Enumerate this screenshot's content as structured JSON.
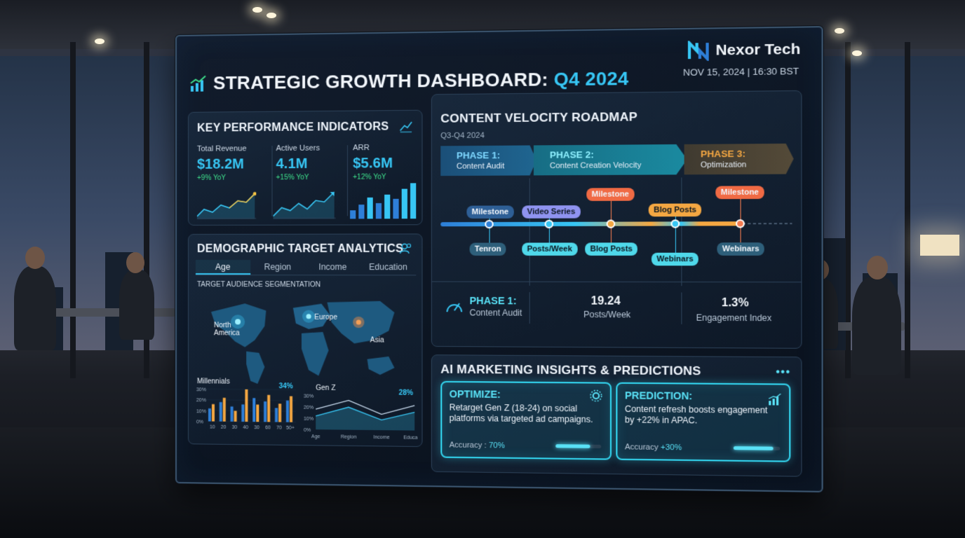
{
  "header": {
    "title_main": "STRATEGIC GROWTH DASHBOARD:",
    "title_highlight": "Q4 2024",
    "brand": "Nexor Tech",
    "timestamp": "NOV 15, 2024 | 16:30 BST"
  },
  "kpi": {
    "title": "KEY PERFORMANCE INDICATORS",
    "items": [
      {
        "label": "Total Revenue",
        "value": "$18.2M",
        "delta": "+9% YoY"
      },
      {
        "label": "Active Users",
        "value": "4.1M",
        "delta": "+15% YoY"
      },
      {
        "label": "ARR",
        "value": "$5.6M",
        "delta": "+12% YoY"
      }
    ],
    "colors": {
      "value": "#37c6f4",
      "delta": "#3ee08c"
    }
  },
  "demographic": {
    "title": "DEMOGRAPHIC TARGET ANALYTICS",
    "tabs": [
      "Age",
      "Region",
      "Income",
      "Education"
    ],
    "active_tab": "Age",
    "segmentation_title": "TARGET AUDIENCE SEGMENTATION",
    "regions": [
      "North America",
      "Europe",
      "Asia"
    ],
    "millennials": {
      "title": "Millennials",
      "pct": "34%",
      "y_ticks": [
        "30%",
        "20%",
        "10%",
        "0%"
      ],
      "x_ticks": [
        "10",
        "20",
        "30",
        "40",
        "30",
        "60",
        "70",
        "50+"
      ]
    },
    "genz": {
      "title": "Gen Z",
      "pct": "28%",
      "y_ticks": [
        "30%",
        "20%",
        "10%",
        "0%"
      ],
      "x_ticks": [
        "Age",
        "Region",
        "Income",
        "Education"
      ]
    }
  },
  "chart_data": [
    {
      "type": "bar",
      "title": "Millennials",
      "categories": [
        "10",
        "20",
        "30",
        "40",
        "30",
        "60",
        "70",
        "50+"
      ],
      "series": [
        {
          "values": [
            12,
            18,
            14,
            16,
            22,
            19,
            13,
            20
          ]
        },
        {
          "values": [
            16,
            22,
            10,
            30,
            16,
            25,
            17,
            24
          ]
        }
      ],
      "ylim": [
        0,
        30
      ]
    },
    {
      "type": "line",
      "title": "Gen Z",
      "categories": [
        "Age",
        "Region",
        "Income",
        "Education"
      ],
      "series": [
        {
          "values": [
            18,
            26,
            14,
            22
          ]
        },
        {
          "values": [
            12,
            20,
            9,
            16
          ]
        }
      ],
      "ylim": [
        0,
        30
      ]
    }
  ],
  "roadmap": {
    "title": "CONTENT VELOCITY ROADMAP",
    "subtitle": "Q3-Q4 2024",
    "phases": [
      {
        "title": "PHASE 1:",
        "sub": "Content Audit"
      },
      {
        "title": "PHASE 2:",
        "sub": "Content Creation Velocity"
      },
      {
        "title": "PHASE 3:",
        "sub": "Optimization"
      }
    ],
    "top_labels": [
      "Milestone",
      "Video Series",
      "Milestone",
      "Blog Posts",
      "Milestone"
    ],
    "bottom_labels": [
      "Tenron",
      "Posts/Week",
      "Blog Posts",
      "Webinars",
      "Webinars"
    ],
    "stats": {
      "phase_title": "PHASE 1:",
      "phase_sub": "Content Audit",
      "posts_value": "19.24",
      "posts_label": "Posts/Week",
      "engagement_value": "1.3%",
      "engagement_label": "Engagement Index"
    }
  },
  "ai": {
    "title": "AI MARKETING INSIGHTS & PREDICTIONS",
    "menu": "•••",
    "cards": [
      {
        "title": "OPTIMIZE:",
        "text": "Retarget Gen Z (18-24) on social platforms via targeted ad campaigns.",
        "acc_label": "Accuracy :",
        "acc_value": "70%",
        "fill": 0.75
      },
      {
        "title": "PREDICTION:",
        "text": "Content refresh boosts engagement by +22% in APAC.",
        "acc_label": "Accuracy",
        "acc_value": "+30%",
        "fill": 0.85
      }
    ],
    "accent": "#59e1f6"
  }
}
